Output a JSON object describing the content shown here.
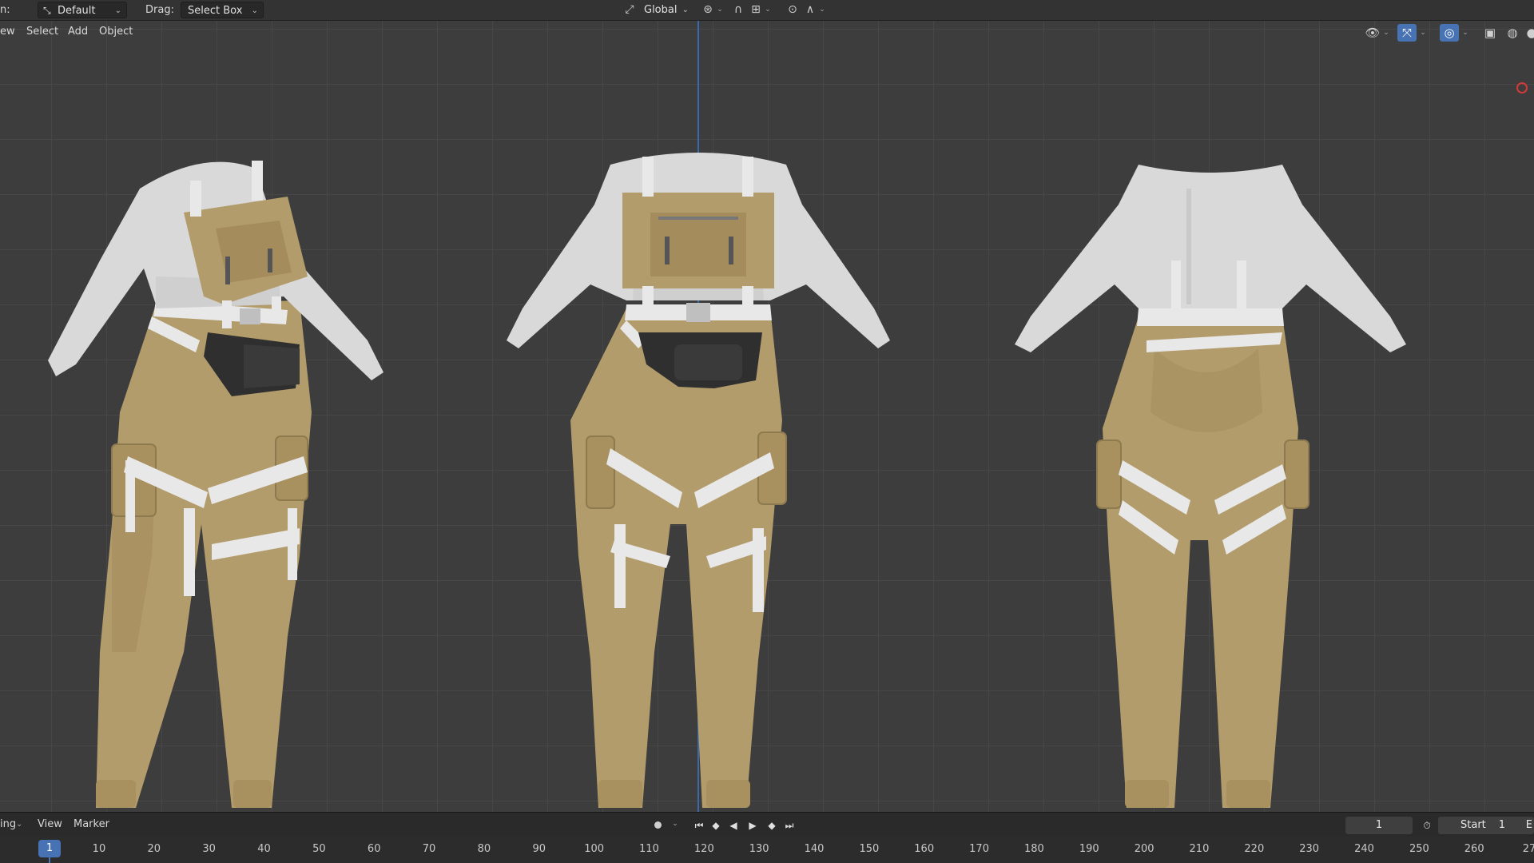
{
  "topbar": {
    "mode_fragment": "n:",
    "orientation_value": "Default",
    "drag_label": "Drag:",
    "drag_value": "Select Box",
    "transform_space": "Global"
  },
  "viewport": {
    "menus": [
      "ew",
      "Select",
      "Add",
      "Object"
    ],
    "background_color": "#3d3d3d",
    "grid_color": "#474747",
    "axis_color": "#3c6aa8",
    "active_tool_color": "#4772b3",
    "figures": [
      {
        "view": "front-three-quarter",
        "top_color": "#d9d9d9",
        "pants_color": "#b39c6b",
        "strap_color": "#e8e8e8",
        "pouch_color": "#2f2f2f"
      },
      {
        "view": "front",
        "top_color": "#d9d9d9",
        "pants_color": "#b39c6b",
        "strap_color": "#e8e8e8",
        "pouch_color": "#2f2f2f"
      },
      {
        "view": "back",
        "top_color": "#d9d9d9",
        "pants_color": "#b39c6b",
        "strap_color": "#e8e8e8",
        "pouch_color": "#2f2f2f"
      }
    ]
  },
  "timeline": {
    "menus": [
      "ing",
      "View",
      "Marker"
    ],
    "current_frame": "1",
    "start_label": "Start",
    "start_value": "1",
    "end_fragment": "E",
    "ruler_current": "1",
    "ruler_ticks": [
      "10",
      "20",
      "30",
      "40",
      "50",
      "60",
      "70",
      "80",
      "90",
      "100",
      "110",
      "120",
      "130",
      "140",
      "150",
      "160",
      "170",
      "180",
      "190",
      "200",
      "210",
      "220",
      "230",
      "240",
      "250",
      "260",
      "27"
    ]
  }
}
